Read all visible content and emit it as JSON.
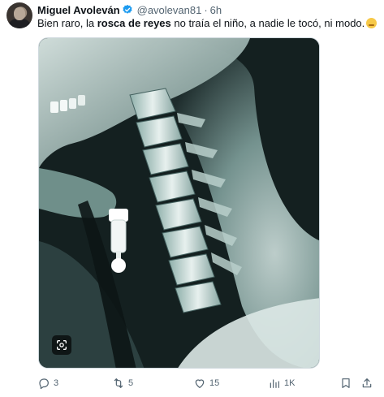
{
  "tweet": {
    "author_name": "Miguel Avoleván",
    "handle": "@avolevan81",
    "separator": "·",
    "time": "6h",
    "text_before": "Bien raro, la ",
    "text_bold": "rosca de reyes",
    "text_after": " no traía el niño, a nadie le tocó, ni modo."
  },
  "media": {
    "alt_icon": "lens-search-icon",
    "theme": {
      "bone": "#e8f0ee",
      "dark": "#0d1616",
      "tint": "#6f8f8c"
    }
  },
  "actions": {
    "replies": "3",
    "reposts": "5",
    "likes": "15",
    "views": "1K"
  },
  "colors": {
    "text": "#0f1419",
    "secondary": "#536471",
    "verified": "#1d9bf0"
  }
}
